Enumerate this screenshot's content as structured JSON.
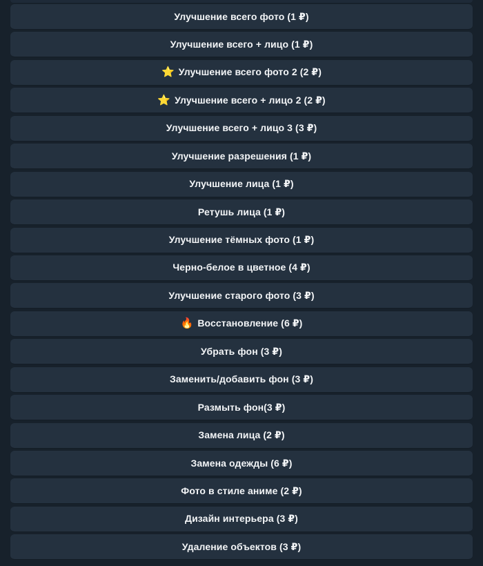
{
  "colors": {
    "background": "#17212b",
    "button": "#24313f",
    "text": "#f3f5f7",
    "star": "#f7c33a",
    "fire": "#ff7a1a"
  },
  "buttons": [
    {
      "emoji": "",
      "icon": "",
      "label": "Улучшение всего фото (1 ₽)"
    },
    {
      "emoji": "",
      "icon": "",
      "label": "Улучшение всего + лицо (1 ₽)"
    },
    {
      "emoji": "⭐",
      "icon": "star-icon",
      "label": "Улучшение всего фото 2 (2 ₽)"
    },
    {
      "emoji": "⭐",
      "icon": "star-icon",
      "label": "Улучшение всего + лицо 2 (2 ₽)"
    },
    {
      "emoji": "",
      "icon": "",
      "label": "Улучшение всего + лицо 3 (3 ₽)"
    },
    {
      "emoji": "",
      "icon": "",
      "label": "Улучшение разрешения (1 ₽)"
    },
    {
      "emoji": "",
      "icon": "",
      "label": "Улучшение лица (1 ₽)"
    },
    {
      "emoji": "",
      "icon": "",
      "label": "Ретушь лица (1 ₽)"
    },
    {
      "emoji": "",
      "icon": "",
      "label": "Улучшение тёмных фото (1 ₽)"
    },
    {
      "emoji": "",
      "icon": "",
      "label": "Черно-белое в цветное (4 ₽)"
    },
    {
      "emoji": "",
      "icon": "",
      "label": "Улучшение старого фото (3 ₽)"
    },
    {
      "emoji": "🔥",
      "icon": "fire-icon",
      "label": "Восстановление (6 ₽)"
    },
    {
      "emoji": "",
      "icon": "",
      "label": "Убрать фон (3 ₽)"
    },
    {
      "emoji": "",
      "icon": "",
      "label": "Заменить/добавить фон (3 ₽)"
    },
    {
      "emoji": "",
      "icon": "",
      "label": "Размыть фон(3 ₽)"
    },
    {
      "emoji": "",
      "icon": "",
      "label": "Замена лица (2 ₽)"
    },
    {
      "emoji": "",
      "icon": "",
      "label": "Замена одежды (6 ₽)"
    },
    {
      "emoji": "",
      "icon": "",
      "label": "Фото в стиле аниме (2 ₽)"
    },
    {
      "emoji": "",
      "icon": "",
      "label": "Дизайн интерьера (3 ₽)"
    },
    {
      "emoji": "",
      "icon": "",
      "label": "Удаление объектов (3 ₽)"
    }
  ]
}
